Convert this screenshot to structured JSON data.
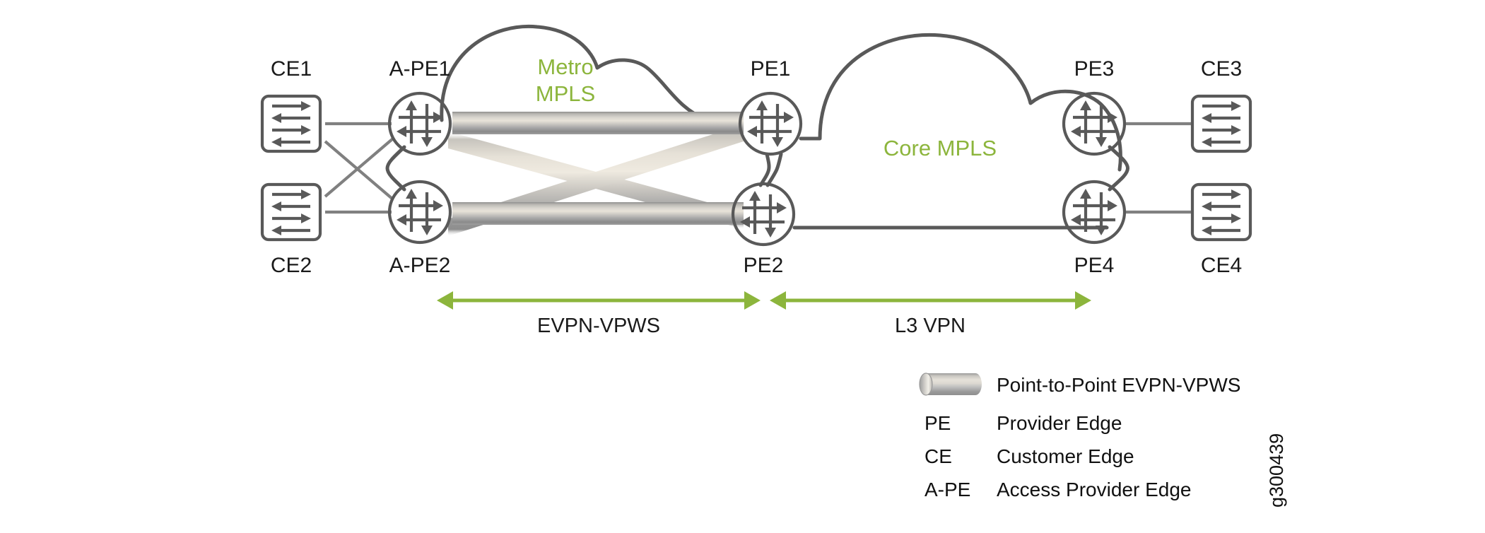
{
  "figure": {
    "watermark": "g300439",
    "accent_green": "#8cb53c",
    "device_gray": "#595959",
    "link_gray": "#808080",
    "background": "#ffffff"
  },
  "clouds": [
    {
      "id": "metro",
      "label_line1": "Metro",
      "label_line2": "MPLS",
      "color": "#8cb53c"
    },
    {
      "id": "core",
      "label_line1": "Core MPLS",
      "label_line2": "",
      "color": "#8cb53c"
    }
  ],
  "nodes": [
    {
      "id": "ce1",
      "label": "CE1",
      "type": "switch",
      "label_pos": "top"
    },
    {
      "id": "ce2",
      "label": "CE2",
      "type": "switch",
      "label_pos": "bottom"
    },
    {
      "id": "ape1",
      "label": "A-PE1",
      "type": "router",
      "label_pos": "top"
    },
    {
      "id": "ape2",
      "label": "A-PE2",
      "type": "router",
      "label_pos": "bottom"
    },
    {
      "id": "pe1",
      "label": "PE1",
      "type": "router",
      "label_pos": "top"
    },
    {
      "id": "pe2",
      "label": "PE2",
      "type": "router",
      "label_pos": "bottom"
    },
    {
      "id": "pe3",
      "label": "PE3",
      "type": "router",
      "label_pos": "top"
    },
    {
      "id": "pe4",
      "label": "PE4",
      "type": "router",
      "label_pos": "bottom"
    },
    {
      "id": "ce3",
      "label": "CE3",
      "type": "switch",
      "label_pos": "top"
    },
    {
      "id": "ce4",
      "label": "CE4",
      "type": "switch",
      "label_pos": "bottom"
    }
  ],
  "spans": [
    {
      "id": "evpn-vpws",
      "label": "EVPN-VPWS"
    },
    {
      "id": "l3vpn",
      "label": "L3 VPN"
    }
  ],
  "legend": {
    "items": [
      {
        "id": "pipe",
        "swatch": "pipe-cylinder",
        "abbr": "",
        "desc": "Point-to-Point EVPN-VPWS"
      },
      {
        "id": "pe",
        "swatch": "",
        "abbr": "PE",
        "desc": "Provider Edge"
      },
      {
        "id": "ce",
        "swatch": "",
        "abbr": "CE",
        "desc": "Customer Edge"
      },
      {
        "id": "a-pe",
        "swatch": "",
        "abbr": "A-PE",
        "desc": "Access Provider Edge"
      }
    ]
  }
}
